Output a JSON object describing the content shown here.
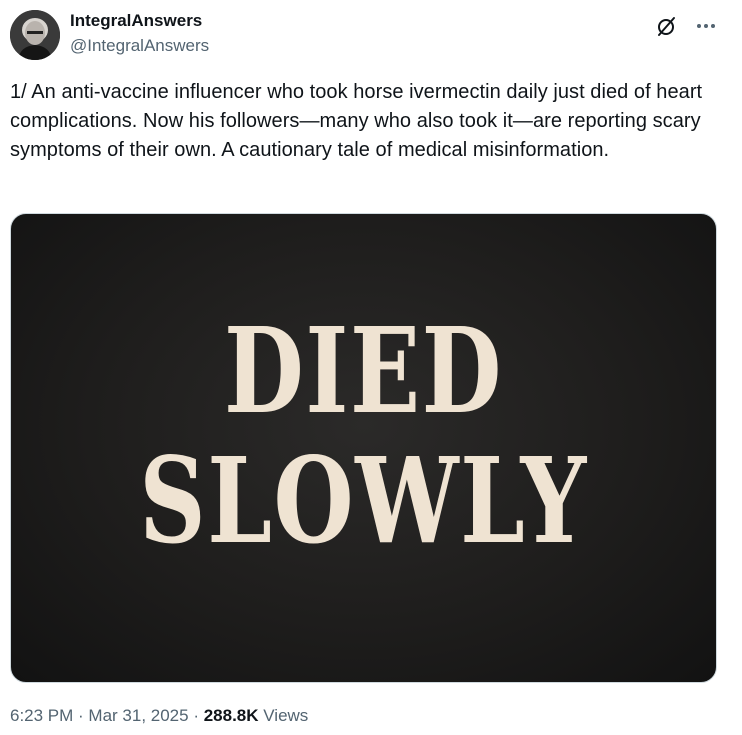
{
  "author": {
    "display_name": "IntegralAnswers",
    "handle": "@IntegralAnswers"
  },
  "header_icons": {
    "grok": "grok-icon",
    "more": "more-horizontal-icon"
  },
  "tweet": {
    "text": "1/ An anti-vaccine influencer who took horse ivermectin daily just died of heart complications. Now his followers—many who also took it—are reporting scary symptoms of their own. A cautionary tale of medical misinformation."
  },
  "media": {
    "line1": "DIED",
    "line2": "SLOWLY",
    "background_color": "#1c1b1a",
    "text_color": "#efe3d2"
  },
  "meta": {
    "time": "6:23 PM",
    "separator1": " · ",
    "date": "Mar 31, 2025",
    "separator2": " · ",
    "views_count": "288.8K",
    "views_label": " Views"
  }
}
